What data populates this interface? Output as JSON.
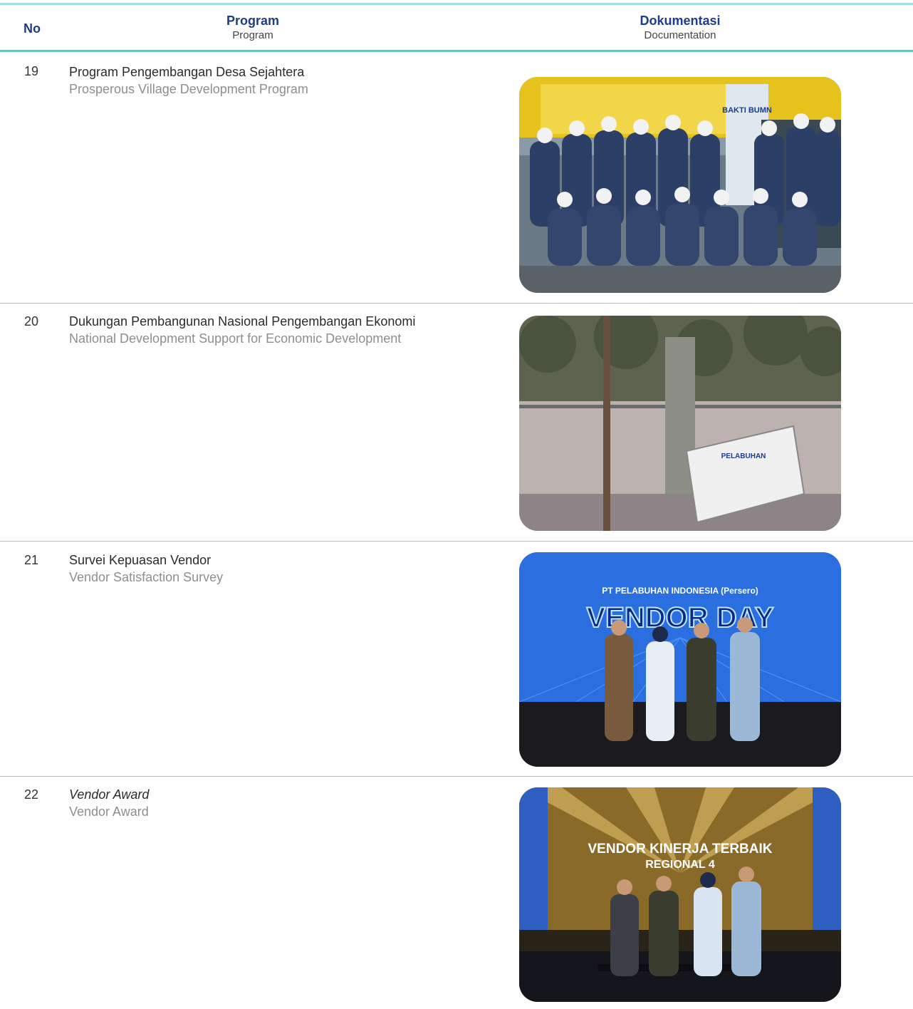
{
  "table": {
    "header": {
      "no": "No",
      "program_id": "Program",
      "program_en": "Program",
      "doc_id": "Dokumentasi",
      "doc_en": "Documentation"
    },
    "rows": [
      {
        "no": "19",
        "program_id": "Program Pengembangan Desa Sejahtera",
        "program_en": "Prosperous Village Development Program",
        "photo": {
          "banner_text": "BAKTI BUMN",
          "description": "group-photo-volunteers"
        }
      },
      {
        "no": "20",
        "program_id": "Dukungan Pembangunan Nasional Pengembangan Ekonomi",
        "program_en": "National Development Support for Economic Development",
        "photo": {
          "sign_text": "PELABUHAN",
          "description": "road-construction-sign"
        }
      },
      {
        "no": "21",
        "program_id": "Survei Kepuasan Vendor",
        "program_en": "Vendor Satisfaction Survey",
        "photo": {
          "stage_line1": "PT PELABUHAN INDONESIA (Persero)",
          "stage_line2": "VENDOR DAY",
          "description": "vendor-day-stage"
        }
      },
      {
        "no": "22",
        "program_id": "Vendor Award",
        "program_en": "Vendor Award",
        "photo": {
          "stage_line1": "VENDOR KINERJA TERBAIK",
          "stage_line2": "REGIONAL 4",
          "description": "vendor-award-stage"
        }
      }
    ]
  },
  "colors": {
    "header_text": "#1f3b8c",
    "header_rule": "#68c6c9",
    "row_separator": "#bfbfbf",
    "english_text": "#8e8e8e"
  }
}
